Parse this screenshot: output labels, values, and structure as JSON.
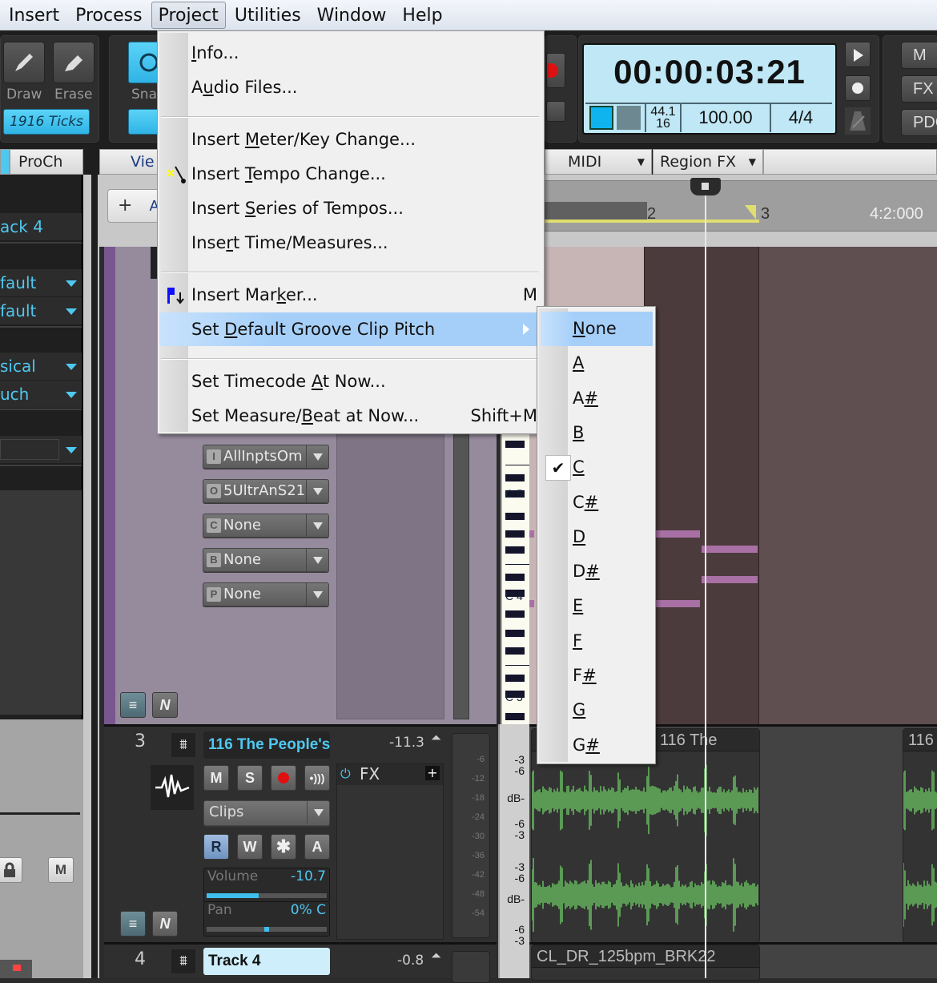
{
  "menubar": {
    "items": [
      "Insert",
      "Process",
      "Project",
      "Utilities",
      "Window",
      "Help"
    ],
    "active": "Project"
  },
  "toolbar": {
    "draw_label": "Draw",
    "erase_label": "Erase",
    "snap_label": "Sna",
    "ticks_label": "1916 Ticks",
    "time": "00:00:03:21",
    "sample_rate": "44.1",
    "bit_depth": "16",
    "tempo": "100.00",
    "meter": "4/4",
    "right_buttons": [
      "M",
      "FX",
      "PDC"
    ]
  },
  "tabs": {
    "left": [
      "ProCh"
    ],
    "view_label": "Vie",
    "midi_label": "MIDI",
    "region_fx_label": "Region FX",
    "add_track_label": "A"
  },
  "inspector": {
    "track_name": "ack 4",
    "rows": [
      "fault",
      "fault",
      "sical",
      "uch"
    ]
  },
  "ruler": {
    "labels": [
      "2",
      "3",
      "4:2:000"
    ]
  },
  "midi_track": {
    "io": [
      {
        "badge": "I",
        "value": "AllInptsOm"
      },
      {
        "badge": "O",
        "value": "5UltrAnS21"
      },
      {
        "badge": "C",
        "value": "None"
      },
      {
        "badge": "B",
        "value": "None"
      },
      {
        "badge": "P",
        "value": "None"
      }
    ],
    "piano_labels": [
      "C 5",
      "C 4",
      "C 3"
    ]
  },
  "track3": {
    "number": "3",
    "name": "116 The People's",
    "level": "-11.3",
    "buttons": [
      "M",
      "S",
      "",
      ""
    ],
    "mode": "Clips",
    "auto_buttons": [
      "R",
      "W",
      "✱",
      "A"
    ],
    "fx_label": "FX",
    "volume_label": "Volume",
    "volume_value": "-10.7",
    "volume_fraction": 0.43,
    "pan_label": "Pan",
    "pan_value": "0% C",
    "pan_fraction": 0.5,
    "meter_ticks": [
      "-6",
      "-12",
      "-18",
      "-24",
      "-30",
      "-36",
      "-42",
      "-48",
      "-54"
    ],
    "clip_titles": [
      "116 The",
      "116"
    ],
    "db_labels": [
      "-3",
      "-6",
      "dB-",
      "-6",
      "-3",
      "-3",
      "-6",
      "dB-",
      "-6",
      "-3"
    ]
  },
  "track4": {
    "number": "4",
    "name": "Track 4",
    "level": "-0.8",
    "clip_title": "CL_DR_125bpm_BRK22"
  },
  "project_menu": {
    "items": [
      {
        "label_pre": "",
        "accel": "I",
        "label_post": "nfo...",
        "shortcut": "",
        "icon": ""
      },
      {
        "label_pre": "A",
        "accel": "u",
        "label_post": "dio Files...",
        "shortcut": "",
        "icon": ""
      },
      {
        "sep": true
      },
      {
        "label_pre": "Insert ",
        "accel": "M",
        "label_post": "eter/Key Change...",
        "shortcut": "",
        "icon": ""
      },
      {
        "label_pre": "Insert ",
        "accel": "T",
        "label_post": "empo Change...",
        "shortcut": "",
        "icon": "tempo-wand-icon"
      },
      {
        "label_pre": "Insert ",
        "accel": "S",
        "label_post": "eries of Tempos...",
        "shortcut": "",
        "icon": ""
      },
      {
        "label_pre": "Inse",
        "accel": "r",
        "label_post": "t Time/Measures...",
        "shortcut": "",
        "icon": ""
      },
      {
        "sep": true
      },
      {
        "label_pre": "Insert Mar",
        "accel": "k",
        "label_post": "er...",
        "shortcut": "M",
        "icon": "marker-flag-icon"
      },
      {
        "label_pre": "Set ",
        "accel": "D",
        "label_post": "efault Groove Clip Pitch",
        "shortcut": "",
        "icon": "",
        "submenu": true,
        "highlighted": true
      },
      {
        "sep": true
      },
      {
        "label_pre": "Set Timecode ",
        "accel": "A",
        "label_post": "t Now...",
        "shortcut": "",
        "icon": ""
      },
      {
        "label_pre": "Set Measure/",
        "accel": "B",
        "label_post": "eat at Now...",
        "shortcut": "Shift+M",
        "icon": ""
      }
    ]
  },
  "pitch_menu": {
    "items": [
      {
        "pre": "",
        "accel": "N",
        "post": "one",
        "highlighted": true,
        "checked": false
      },
      {
        "pre": "",
        "accel": "A",
        "post": "",
        "checked": false
      },
      {
        "pre": "A",
        "accel": "#",
        "post": "",
        "checked": false
      },
      {
        "pre": "",
        "accel": "B",
        "post": "",
        "checked": false
      },
      {
        "pre": "",
        "accel": "C",
        "post": "",
        "checked": true
      },
      {
        "pre": "C",
        "accel": "#",
        "post": "",
        "checked": false
      },
      {
        "pre": "",
        "accel": "D",
        "post": "",
        "checked": false
      },
      {
        "pre": "D",
        "accel": "#",
        "post": "",
        "checked": false
      },
      {
        "pre": "",
        "accel": "E",
        "post": "",
        "checked": false
      },
      {
        "pre": "",
        "accel": "F",
        "post": "",
        "checked": false
      },
      {
        "pre": "F",
        "accel": "#",
        "post": "",
        "checked": false
      },
      {
        "pre": "",
        "accel": "G",
        "post": "",
        "checked": false
      },
      {
        "pre": "G",
        "accel": "#",
        "post": "",
        "checked": false
      }
    ],
    "check_glyph": "✔"
  },
  "colors": {
    "accent": "#4fc8f0",
    "menu_highlight": "#a5cff9",
    "waveform": "#5b9a55",
    "midi_note": "#a870a4"
  }
}
